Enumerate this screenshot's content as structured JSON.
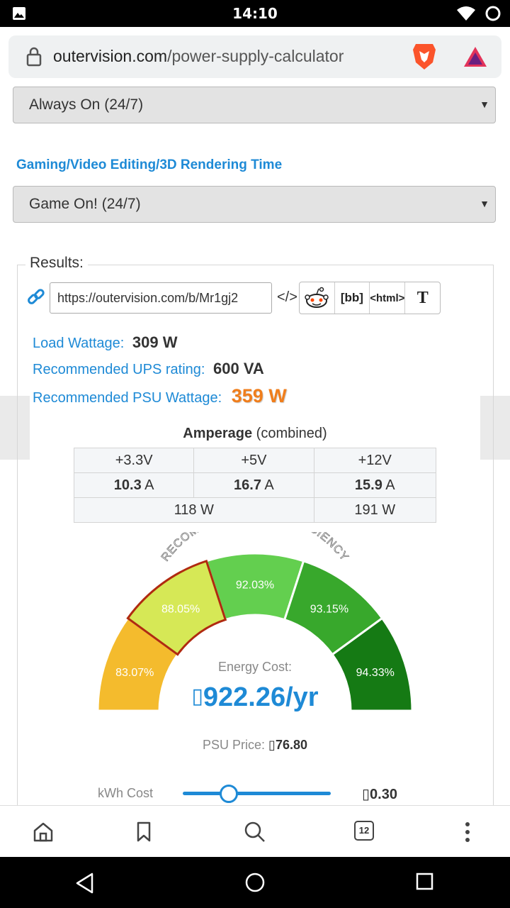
{
  "status_bar": {
    "time": "14:10"
  },
  "url_bar": {
    "domain": "outervision.com",
    "path": "/power-supply-calculator"
  },
  "form": {
    "usage_select_value": "Always On (24/7)",
    "gaming_label": "Gaming/Video Editing/3D Rendering Time",
    "gaming_select_value": "Game On! (24/7)"
  },
  "results": {
    "legend": "Results:",
    "share_url": "https://outervision.com/b/Mr1gj2",
    "embed_icon": "</>",
    "share_buttons": [
      "[bb]",
      "<html>",
      "T"
    ],
    "load_wattage_label": "Load Wattage:",
    "load_wattage_value": "309 W",
    "ups_label": "Recommended UPS rating:",
    "ups_value": "600 VA",
    "psu_label": "Recommended PSU Wattage:",
    "psu_value": "359 W",
    "amperage_title_bold": "Amperage",
    "amperage_title_rest": "(combined)",
    "amperage": {
      "headers": [
        "+3.3V",
        "+5V",
        "+12V"
      ],
      "amps": [
        {
          "value": "10.3",
          "unit": "A"
        },
        {
          "value": "16.7",
          "unit": "A"
        },
        {
          "value": "15.9",
          "unit": "A"
        }
      ],
      "watts": [
        "118 W",
        "191 W"
      ]
    },
    "efficiency": {
      "arc_title": "RECOMMENDED PSU EFFICIENCY",
      "segments": [
        {
          "label": "83.07%",
          "color": "#f4bb2d"
        },
        {
          "label": "88.05%",
          "color": "#d6e856",
          "selected": true
        },
        {
          "label": "92.03%",
          "color": "#63cf4f"
        },
        {
          "label": "93.15%",
          "color": "#38a82c"
        },
        {
          "label": "94.33%",
          "color": "#157a14"
        }
      ]
    },
    "energy_cost_label": "Energy Cost:",
    "energy_cost_value": "922.26/yr",
    "psu_price_label": "PSU Price:",
    "psu_price_value": "76.80",
    "kwh_label": "kWh Cost",
    "kwh_value": "0.30",
    "kwh_slider_fraction": 0.31
  },
  "toolbar": {
    "tab_count": "12"
  },
  "colors": {
    "accent": "#1e8ad6",
    "psu_orange": "#f07e1c"
  }
}
